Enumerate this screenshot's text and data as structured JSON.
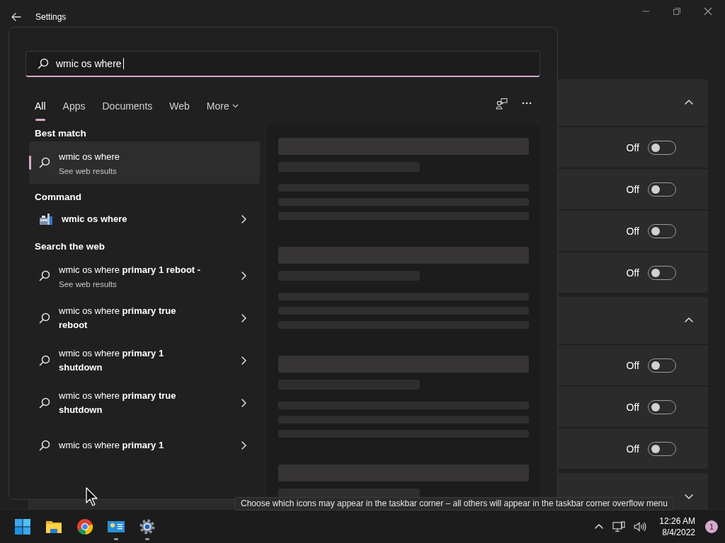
{
  "window": {
    "title": "Settings"
  },
  "search": {
    "value": "wmic os where"
  },
  "tabs": [
    {
      "label": "All",
      "selected": true,
      "kind": "tab"
    },
    {
      "label": "Apps",
      "selected": false,
      "kind": "tab"
    },
    {
      "label": "Documents",
      "selected": false,
      "kind": "tab"
    },
    {
      "label": "Web",
      "selected": false,
      "kind": "tab"
    },
    {
      "label": "More",
      "selected": false,
      "kind": "dropdown"
    }
  ],
  "sections": [
    {
      "heading": "Best match",
      "items": [
        {
          "kind": "web",
          "title": "wmic os where",
          "subtitle": "See web results",
          "selected": true
        }
      ]
    },
    {
      "heading": "Command",
      "items": [
        {
          "kind": "app",
          "title": "wmic os where",
          "selected": false
        }
      ]
    },
    {
      "heading": "Search the web",
      "items": [
        {
          "kind": "web",
          "title": "wmic os where **primary 1 reboot -**",
          "subtitle": "See web results",
          "selected": false
        },
        {
          "kind": "web",
          "title": "wmic os where **primary true reboot**",
          "selected": false
        },
        {
          "kind": "web",
          "title": "wmic os where **primary 1 shutdown**",
          "selected": false
        },
        {
          "kind": "web",
          "title": "wmic os where **primary true shutdown**",
          "selected": false
        },
        {
          "kind": "web",
          "title": "wmic os where **primary 1**",
          "selected": false
        }
      ]
    }
  ],
  "settings_groups": [
    {
      "expanded": true,
      "rows": [
        {
          "status": "Off",
          "on": false
        },
        {
          "status": "Off",
          "on": false
        },
        {
          "status": "Off",
          "on": false
        },
        {
          "status": "Off",
          "on": false
        }
      ]
    },
    {
      "expanded": true,
      "rows": [
        {
          "status": "Off",
          "on": false
        },
        {
          "status": "Off",
          "on": false
        },
        {
          "status": "Off",
          "on": false
        }
      ]
    },
    {
      "expanded": false
    }
  ],
  "tooltip": "Choose which icons may appear in the taskbar corner – all others will appear in the taskbar corner overflow menu",
  "taskbar": {
    "apps": [
      {
        "kind": "start",
        "running": false
      },
      {
        "kind": "folder",
        "running": false
      },
      {
        "kind": "browser",
        "running": false
      },
      {
        "kind": "window",
        "running": true
      },
      {
        "kind": "gear",
        "running": true
      }
    ],
    "clock": {
      "time": "12:26 AM",
      "date": "8/4/2022"
    },
    "notification_count": "1"
  }
}
